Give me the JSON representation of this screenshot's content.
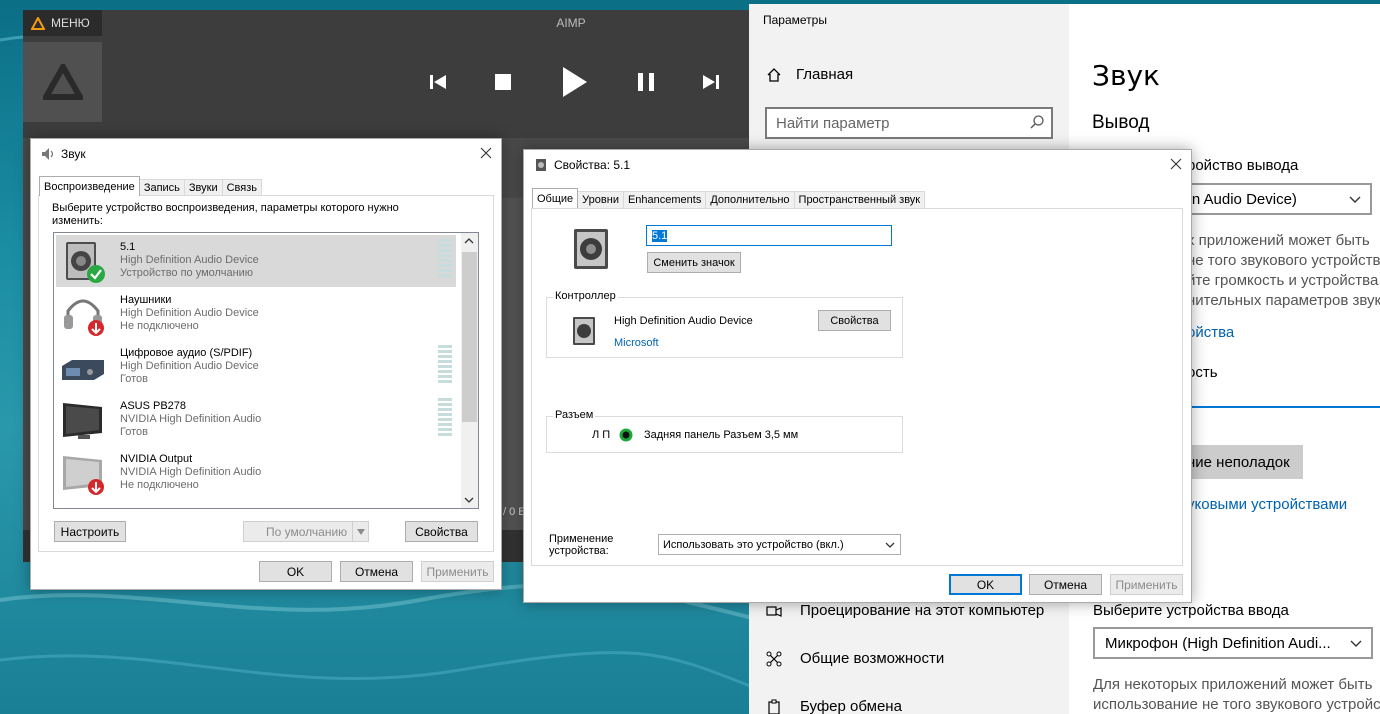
{
  "aimp": {
    "menu_label": "МЕНЮ",
    "title": "AIMP",
    "side_text": "/ 0 Б"
  },
  "settings": {
    "window_title": "Параметры",
    "home_label": "Главная",
    "search_placeholder": "Найти параметр",
    "page_title": "Звук",
    "section_output": "Вывод",
    "choose_output_label": "ройство вывода",
    "output_device_value": "inition Audio Device)",
    "note_line1": "х приложений может быть",
    "note_line2": "не того звукового устройств",
    "note_line3": "йте громкость и устройства",
    "note_line4": "нительных параметров звук",
    "device_props_link": "ойства",
    "volume_label": "ость",
    "troubleshoot_button": "ние неполадок",
    "manage_devices_link": "уковыми устройствами",
    "choose_input_label": "Выберите устройства ввода",
    "input_device_value": "Микрофон (High Definition Audi...",
    "input_note_line1": "Для некоторых приложений может быть",
    "input_note_line2": "использование не того звукового устройст",
    "nav_items": [
      {
        "label": "Проецирование на этот компьютер",
        "icon": "projector-icon"
      },
      {
        "label": "Общие возможности",
        "icon": "shared-icon"
      },
      {
        "label": "Буфер обмена",
        "icon": "clipboard-icon"
      }
    ]
  },
  "sound_dialog": {
    "title": "Звук",
    "tabs": [
      "Воспроизведение",
      "Запись",
      "Звуки",
      "Связь"
    ],
    "instruction": "Выберите устройство воспроизведения, параметры которого нужно изменить:",
    "devices": [
      {
        "name": "5.1",
        "driver": "High Definition Audio Device",
        "status": "Устройство по умолчанию",
        "badge": "default",
        "meter": true
      },
      {
        "name": "Наушники",
        "driver": "High Definition Audio Device",
        "status": "Не подключено",
        "badge": "disconnected",
        "meter": false
      },
      {
        "name": "Цифровое аудио (S/PDIF)",
        "driver": "High Definition Audio Device",
        "status": "Готов",
        "badge": "none",
        "meter": true
      },
      {
        "name": "ASUS PB278",
        "driver": "NVIDIA High Definition Audio",
        "status": "Готов",
        "badge": "none",
        "meter": true
      },
      {
        "name": "NVIDIA Output",
        "driver": "NVIDIA High Definition Audio",
        "status": "Не подключено",
        "badge": "disconnected",
        "meter": false
      }
    ],
    "configure_button": "Настроить",
    "default_button": "По умолчанию",
    "properties_button": "Свойства",
    "ok_button": "OK",
    "cancel_button": "Отмена",
    "apply_button": "Применить"
  },
  "props_dialog": {
    "title": "Свойства: 5.1",
    "tabs": [
      "Общие",
      "Уровни",
      "Enhancements",
      "Дополнительно",
      "Пространственный звук"
    ],
    "name_value": "5.1",
    "change_icon_button": "Сменить значок",
    "controller_group": "Контроллер",
    "controller_name": "High Definition Audio Device",
    "controller_vendor": "Microsoft",
    "controller_props_button": "Свойства",
    "jack_group": "Разъем",
    "jack_channels": "Л П",
    "jack_description": "Задняя панель Разъем 3,5 мм",
    "usage_label": "Применение устройства:",
    "usage_value": "Использовать это устройство (вкл.)",
    "ok_button": "OK",
    "cancel_button": "Отмена",
    "apply_button": "Применить"
  },
  "colors": {
    "accent": "#0078d7",
    "aimp_orange": "#f39c12",
    "link": "#0063b1"
  }
}
